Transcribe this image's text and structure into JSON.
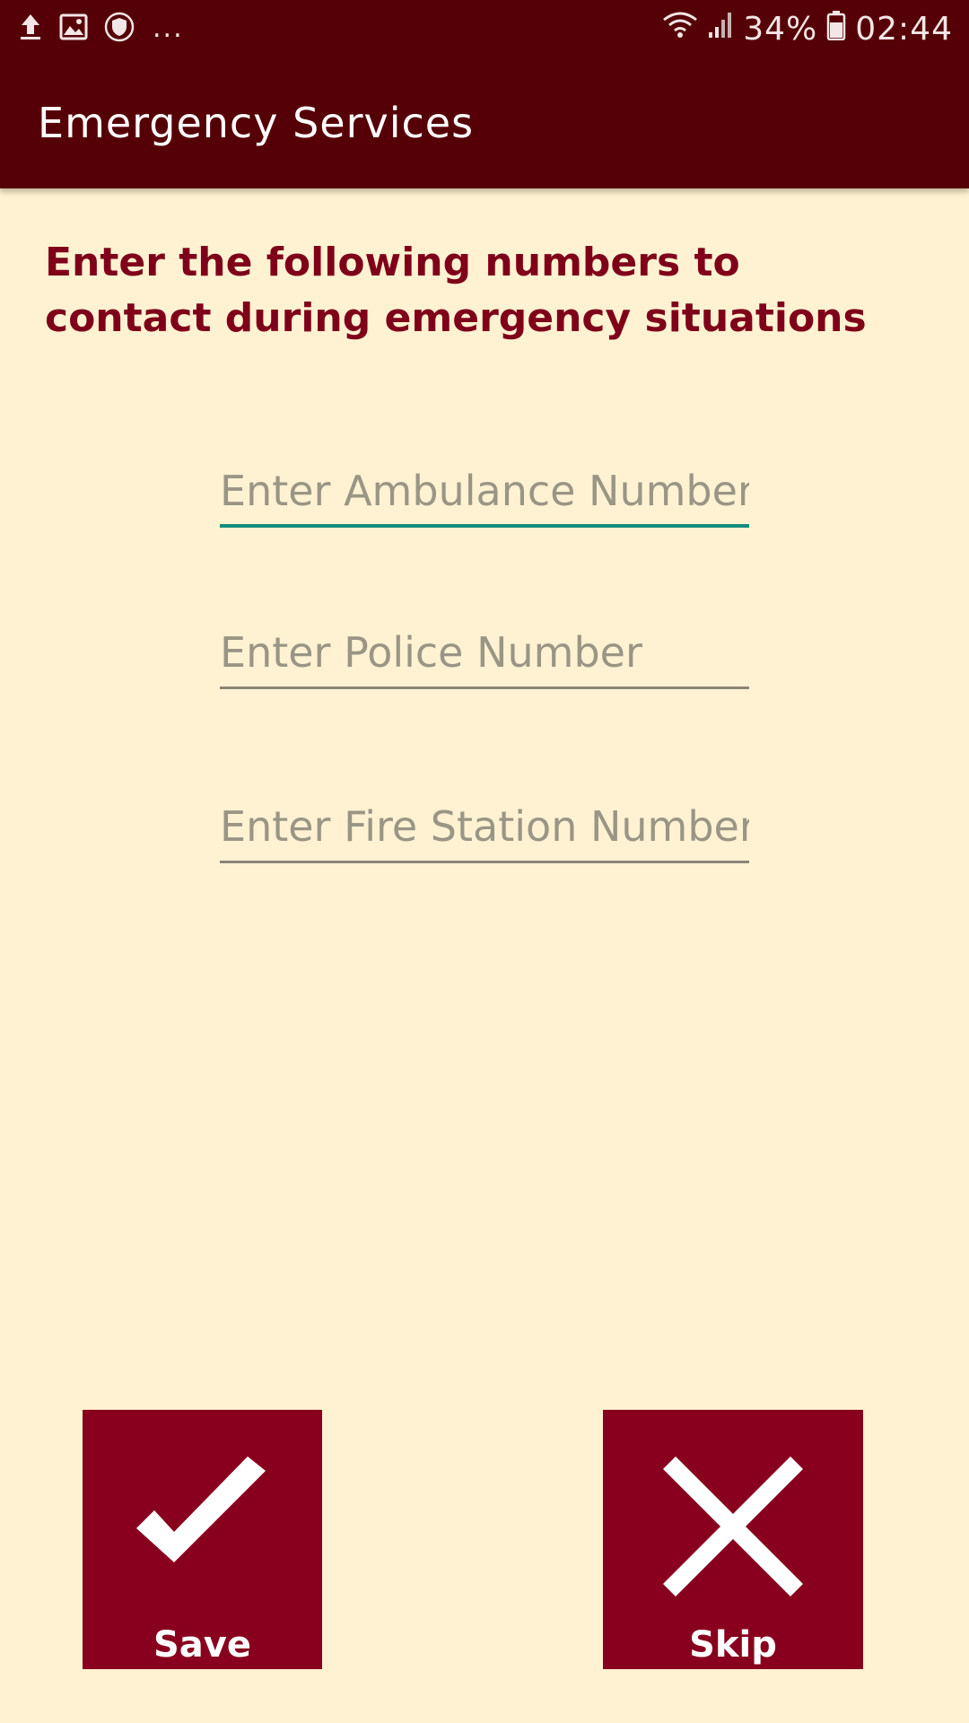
{
  "status_bar": {
    "icons": [
      "upload-icon",
      "image-icon",
      "shield-icon",
      "more-dots",
      "wifi-icon",
      "signal-icon",
      "battery-icon"
    ],
    "more": "...",
    "battery": "34%",
    "time": "02:44"
  },
  "app_bar": {
    "title": "Emergency Services"
  },
  "instruction": "Enter the following numbers to contact during emergency situations",
  "fields": {
    "ambulance": {
      "placeholder": "Enter Ambulance Number",
      "value": ""
    },
    "police": {
      "placeholder": "Enter Police Number",
      "value": ""
    },
    "fire": {
      "placeholder": "Enter Fire Station Number",
      "value": ""
    }
  },
  "buttons": {
    "save": {
      "label": "Save",
      "icon": "check-icon"
    },
    "skip": {
      "label": "Skip",
      "icon": "close-icon"
    }
  },
  "colors": {
    "primary_dark": "#550006",
    "background": "#fff2d2",
    "accent_red": "#88001d",
    "focus_line": "#138d7d"
  }
}
